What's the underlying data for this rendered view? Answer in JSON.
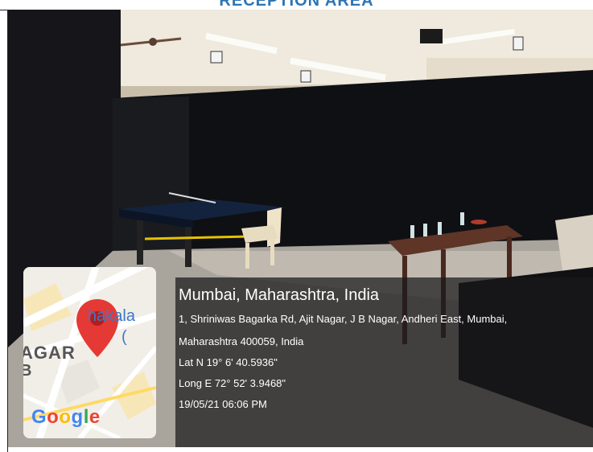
{
  "page": {
    "heading": "RECEPTION AREA"
  },
  "photo": {
    "scene": "indoor-hall-table-tennis"
  },
  "geotag": {
    "location_title": "Mumbai, Maharashtra, India",
    "address_line1": "1, Shriniwas Bagarka Rd, Ajit Nagar, J B Nagar, Andheri East, Mumbai,",
    "address_line2": "Maharashtra 400059, India",
    "latitude": "Lat N 19° 6' 40.5936\"",
    "longitude": "Long E 72° 52' 3.9468\"",
    "timestamp": "19/05/21 06:06 PM"
  },
  "map": {
    "label_chakala": "hakala",
    "label_paren": "(",
    "label_agar": "AGAR",
    "label_b": "B",
    "logo_letters": [
      "G",
      "o",
      "o",
      "g",
      "l",
      "e"
    ],
    "pin_color": "#e53935",
    "pin_icon": "map-pin-icon"
  }
}
